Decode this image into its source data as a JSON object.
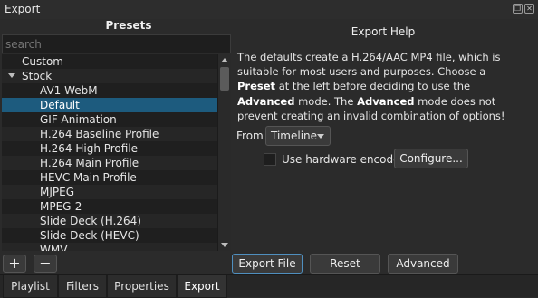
{
  "window": {
    "title": "Export"
  },
  "presets": {
    "title": "Presets",
    "search_placeholder": "search",
    "items": [
      {
        "label": "Custom",
        "level": 0,
        "expandable": false
      },
      {
        "label": "Stock",
        "level": 0,
        "expandable": true
      },
      {
        "label": "AV1 WebM",
        "level": 1
      },
      {
        "label": "Default",
        "level": 1,
        "selected": true
      },
      {
        "label": "GIF Animation",
        "level": 1
      },
      {
        "label": "H.264 Baseline Profile",
        "level": 1
      },
      {
        "label": "H.264 High Profile",
        "level": 1
      },
      {
        "label": "H.264 Main Profile",
        "level": 1
      },
      {
        "label": "HEVC Main Profile",
        "level": 1
      },
      {
        "label": "MJPEG",
        "level": 1
      },
      {
        "label": "MPEG-2",
        "level": 1
      },
      {
        "label": "Slide Deck (H.264)",
        "level": 1
      },
      {
        "label": "Slide Deck (HEVC)",
        "level": 1
      },
      {
        "label": "WMV",
        "level": 1
      }
    ],
    "add_glyph": "+",
    "remove_glyph": "−"
  },
  "help": {
    "title": "Export Help",
    "text_parts": [
      {
        "t": "The defaults create a H.264/AAC MP4 file, which is suitable for most users and purposes. Choose a ",
        "b": false
      },
      {
        "t": "Preset",
        "b": true
      },
      {
        "t": " at the left before deciding to use the ",
        "b": false
      },
      {
        "t": "Advanced",
        "b": true
      },
      {
        "t": " mode. The ",
        "b": false
      },
      {
        "t": "Advanced",
        "b": true
      },
      {
        "t": " mode does not prevent creating an invalid combination of options!",
        "b": false
      }
    ]
  },
  "from": {
    "label": "From",
    "value": "Timeline"
  },
  "hardware": {
    "label": "Use hardware encoder",
    "checked": false,
    "configure_label": "Configure..."
  },
  "actions": {
    "export_file": "Export File",
    "reset": "Reset",
    "advanced": "Advanced"
  },
  "tabs": [
    {
      "label": "Playlist",
      "active": false
    },
    {
      "label": "Filters",
      "active": false
    },
    {
      "label": "Properties",
      "active": false
    },
    {
      "label": "Export",
      "active": true
    }
  ],
  "colors": {
    "selection": "#1d5b7e",
    "background": "#2b2b2b",
    "list_background": "#1f1f1f"
  },
  "icons": {
    "window_float": "float-icon",
    "window_close": "close-icon",
    "add": "plus-icon",
    "remove": "minus-icon"
  }
}
